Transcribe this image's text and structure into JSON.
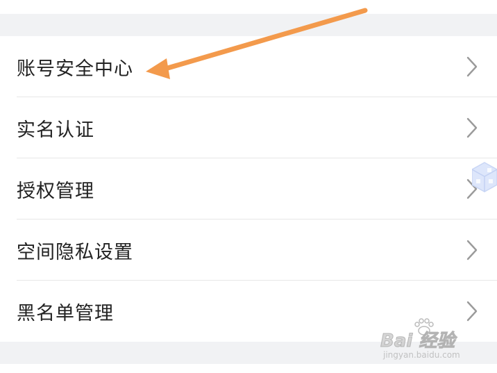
{
  "settings": {
    "items": [
      {
        "label": "账号安全中心"
      },
      {
        "label": "实名认证"
      },
      {
        "label": "授权管理"
      },
      {
        "label": "空间隐私设置"
      },
      {
        "label": "黑名单管理"
      }
    ]
  },
  "icons": {
    "row_chevron": "chevron-right-icon",
    "annotation": "orange-arrow-icon",
    "side_decoration": "cube-icon"
  },
  "watermark": {
    "logo_text": "Bai 经验",
    "url": "jingyan.baidu.com"
  },
  "colors": {
    "background": "#f2f3f5",
    "card": "#ffffff",
    "text": "#222222",
    "divider": "#e6e6e6",
    "chevron": "#9a9a9a",
    "arrow": "#f39a4c",
    "cube": "#c9d6f5"
  }
}
